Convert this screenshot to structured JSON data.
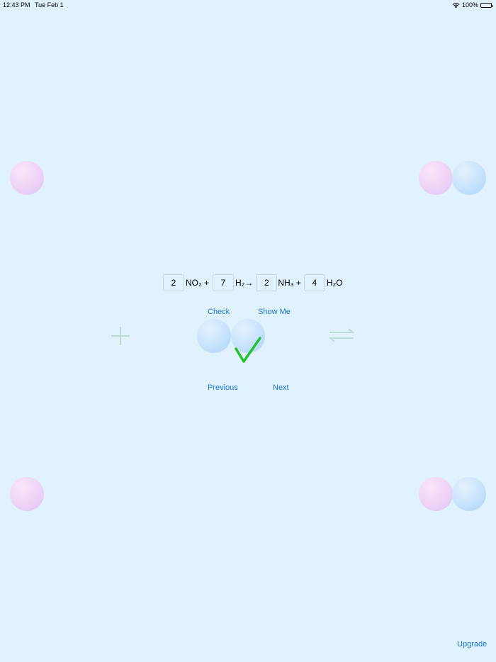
{
  "status_bar": {
    "time": "12:43 PM",
    "date": "Tue Feb 1",
    "battery": "100%",
    "icons": [
      "wifi-icon",
      "battery-icon"
    ]
  },
  "equation": {
    "terms": [
      {
        "coefficient": "2",
        "formula": "NO₂ +"
      },
      {
        "coefficient": "7",
        "formula": "H₂→"
      },
      {
        "coefficient": "2",
        "formula": "NH₃ +"
      },
      {
        "coefficient": "4",
        "formula": "H₂O"
      }
    ]
  },
  "actions": {
    "check": "Check",
    "show_me": "Show Me",
    "previous": "Previous",
    "next": "Next",
    "upgrade": "Upgrade"
  },
  "feedback": {
    "result_icon": "checkmark-icon",
    "result_color": "#22c22e"
  },
  "decor_icons": [
    "plus-icon",
    "reaction-arrows-icon"
  ],
  "colors": {
    "background": "#e0f2fd",
    "link": "#1877d6",
    "pink_sphere": "#eed2f6",
    "blue_sphere": "#c6e2fc",
    "decor_icon": "#b9dccf"
  }
}
